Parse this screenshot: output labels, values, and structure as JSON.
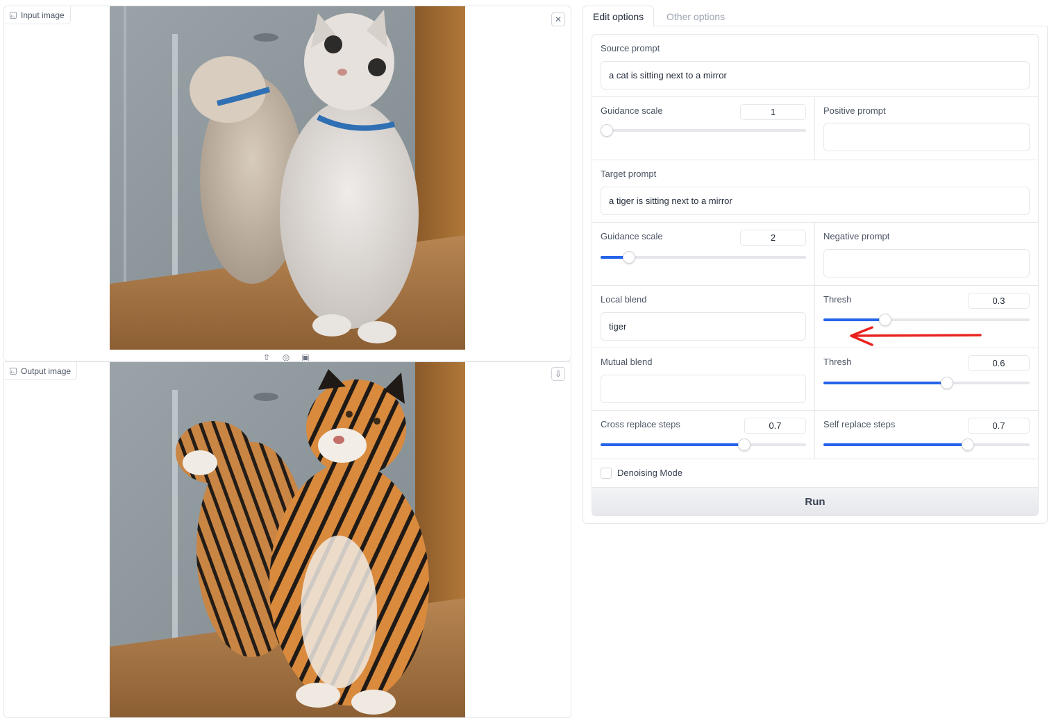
{
  "input_panel": {
    "label": "Input image",
    "icon": "image-icon",
    "clear_icon": "close-icon",
    "toolbar_icons": [
      "upload-icon",
      "webcam-icon",
      "clipboard-icon"
    ]
  },
  "output_panel": {
    "label": "Output image",
    "icon": "image-icon",
    "download_icon": "download-icon"
  },
  "tabs": [
    {
      "label": "Edit options",
      "active": true
    },
    {
      "label": "Other options",
      "active": false
    }
  ],
  "form": {
    "source_prompt": {
      "label": "Source prompt",
      "value": "a cat is sitting next to a mirror"
    },
    "source_guidance": {
      "label": "Guidance scale",
      "value": "1",
      "fraction": 0.0
    },
    "positive_prompt": {
      "label": "Positive prompt",
      "value": ""
    },
    "target_prompt": {
      "label": "Target prompt",
      "value": "a tiger is sitting next to a mirror"
    },
    "target_guidance": {
      "label": "Guidance scale",
      "value": "2",
      "fraction": 0.14
    },
    "negative_prompt": {
      "label": "Negative prompt",
      "value": ""
    },
    "local_blend": {
      "label": "Local blend",
      "value": "tiger"
    },
    "local_thresh": {
      "label": "Thresh",
      "value": "0.3",
      "fraction": 0.3
    },
    "mutual_blend": {
      "label": "Mutual blend",
      "value": ""
    },
    "mutual_thresh": {
      "label": "Thresh",
      "value": "0.6",
      "fraction": 0.6
    },
    "cross_replace": {
      "label": "Cross replace steps",
      "value": "0.7",
      "fraction": 0.7
    },
    "self_replace": {
      "label": "Self replace steps",
      "value": "0.7",
      "fraction": 0.7
    },
    "denoising": {
      "label": "Denoising Mode",
      "checked": false
    },
    "run_label": "Run"
  },
  "colors": {
    "accent": "#2563eb",
    "annotation_arrow": "#e8231f"
  }
}
